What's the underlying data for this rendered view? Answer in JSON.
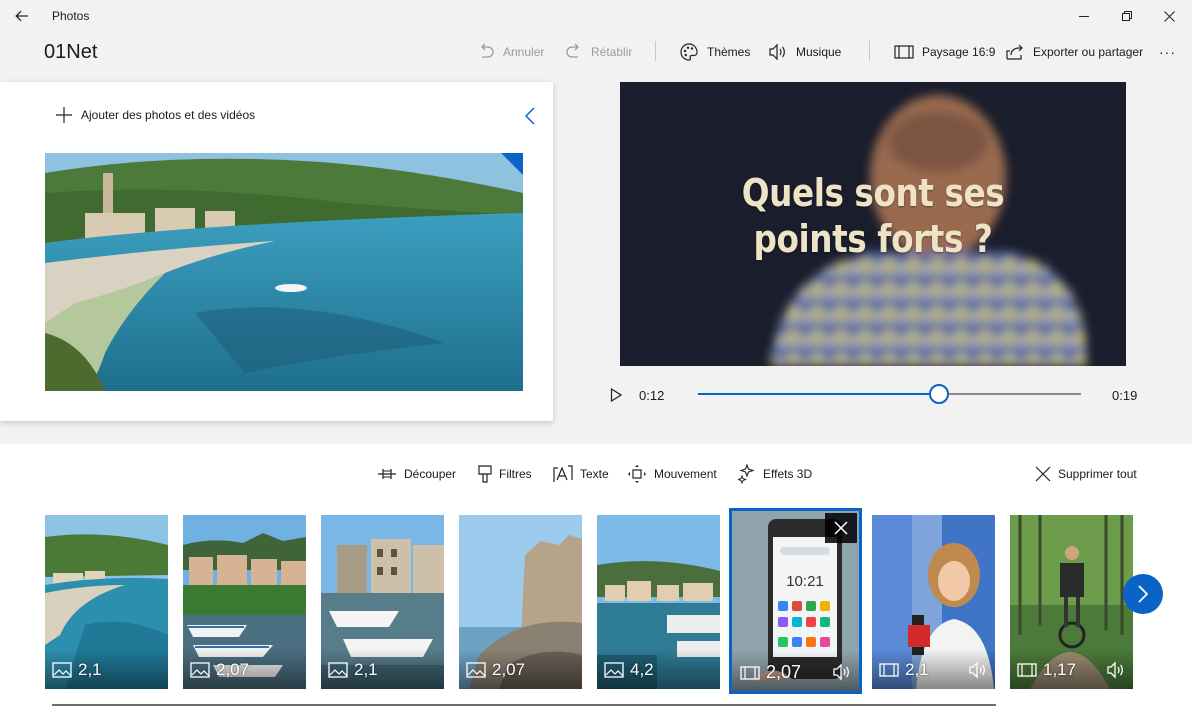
{
  "window": {
    "app_name": "Photos",
    "icons": {
      "back": "arrow-left-icon",
      "minimize": "minimize-icon",
      "maximize": "restore-icon",
      "close": "close-icon"
    }
  },
  "header": {
    "project_title": "01Net",
    "undo_label": "Annuler",
    "redo_label": "Rétablir",
    "themes_label": "Thèmes",
    "music_label": "Musique",
    "aspect_label": "Paysage 16:9",
    "export_label": "Exporter ou partager",
    "more_label": "···"
  },
  "library": {
    "add_label": "Ajouter des photos et des vidéos"
  },
  "preview": {
    "caption_line1": "Quels sont ses",
    "caption_line2": "points forts ?",
    "current_time": "0:12",
    "total_time": "0:19",
    "progress": 0.63
  },
  "storyboard": {
    "tools": {
      "trim": "Découper",
      "filters": "Filtres",
      "text": "Texte",
      "motion": "Mouvement",
      "effects3d": "Effets 3D",
      "remove_all": "Supprimer tout"
    },
    "cards": [
      {
        "duration": "2,1",
        "kind": "photo"
      },
      {
        "duration": "2,07",
        "kind": "photo"
      },
      {
        "duration": "2,1",
        "kind": "photo"
      },
      {
        "duration": "2,07",
        "kind": "photo"
      },
      {
        "duration": "4,2",
        "kind": "photo"
      },
      {
        "duration": "2,07",
        "kind": "video",
        "selected": true
      },
      {
        "duration": "2,1",
        "kind": "video"
      },
      {
        "duration": "1,17",
        "kind": "video"
      }
    ],
    "phone_time": "10:21"
  },
  "colors": {
    "accent": "#0a64c8",
    "caption": "#efe3c6"
  }
}
